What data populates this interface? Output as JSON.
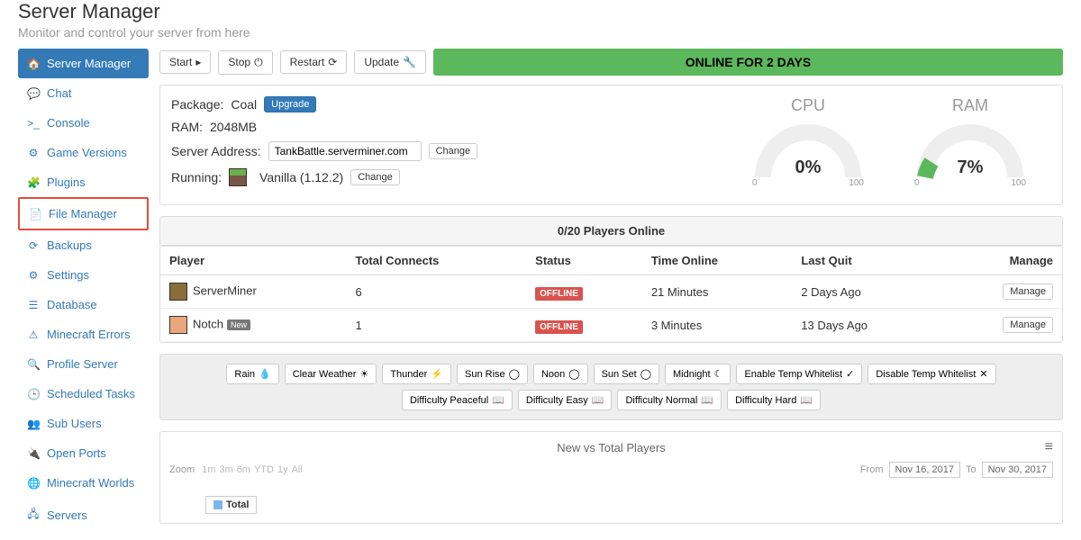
{
  "header": {
    "title": "Server Manager",
    "subtitle": "Monitor and control your server from here"
  },
  "sidebar": {
    "items": [
      {
        "icon": "🏠",
        "label": "Server Manager",
        "name": "server-manager"
      },
      {
        "icon": "💬",
        "label": "Chat",
        "name": "chat"
      },
      {
        "icon": ">_",
        "label": "Console",
        "name": "console"
      },
      {
        "icon": "⚙",
        "label": "Game Versions",
        "name": "game-versions"
      },
      {
        "icon": "🧩",
        "label": "Plugins",
        "name": "plugins"
      },
      {
        "icon": "📄",
        "label": "File Manager",
        "name": "file-manager"
      },
      {
        "icon": "⟳",
        "label": "Backups",
        "name": "backups"
      },
      {
        "icon": "⚙",
        "label": "Settings",
        "name": "settings"
      },
      {
        "icon": "☰",
        "label": "Database",
        "name": "database"
      },
      {
        "icon": "⚠",
        "label": "Minecraft Errors",
        "name": "minecraft-errors"
      },
      {
        "icon": "🔍",
        "label": "Profile Server",
        "name": "profile-server"
      },
      {
        "icon": "🕒",
        "label": "Scheduled Tasks",
        "name": "scheduled-tasks"
      },
      {
        "icon": "👥",
        "label": "Sub Users",
        "name": "sub-users"
      },
      {
        "icon": "🔌",
        "label": "Open Ports",
        "name": "open-ports"
      },
      {
        "icon": "🌐",
        "label": "Minecraft Worlds",
        "name": "minecraft-worlds"
      },
      {
        "icon": "🖧",
        "label": "Servers",
        "name": "servers"
      }
    ]
  },
  "toolbar": {
    "start": "Start",
    "stop": "Stop",
    "restart": "Restart",
    "update": "Update",
    "status": "ONLINE FOR 2 DAYS"
  },
  "info": {
    "package_label": "Package:",
    "package_value": "Coal",
    "upgrade": "Upgrade",
    "ram_label": "RAM:",
    "ram_value": "2048MB",
    "address_label": "Server Address:",
    "address_value": "TankBattle.serverminer.com",
    "change": "Change",
    "running_label": "Running:",
    "running_value": "Vanilla (1.12.2)"
  },
  "gauges": {
    "cpu": {
      "title": "CPU",
      "value": "0%",
      "min": "0",
      "max": "100",
      "pct": 0
    },
    "ram": {
      "title": "RAM",
      "value": "7%",
      "min": "0",
      "max": "100",
      "pct": 7
    }
  },
  "players": {
    "header": "0/20 Players Online",
    "columns": [
      "Player",
      "Total Connects",
      "Status",
      "Time Online",
      "Last Quit",
      "Manage"
    ],
    "rows": [
      {
        "name": "ServerMiner",
        "new": false,
        "connects": "6",
        "status": "OFFLINE",
        "time": "21 Minutes",
        "quit": "2 Days Ago",
        "manage": "Manage"
      },
      {
        "name": "Notch",
        "new": true,
        "connects": "1",
        "status": "OFFLINE",
        "time": "3 Minutes",
        "quit": "13 Days Ago",
        "manage": "Manage"
      }
    ],
    "new_badge": "New"
  },
  "actions": [
    {
      "label": "Rain",
      "icon": "💧"
    },
    {
      "label": "Clear Weather",
      "icon": "☀"
    },
    {
      "label": "Thunder",
      "icon": "⚡"
    },
    {
      "label": "Sun Rise",
      "icon": "◯"
    },
    {
      "label": "Noon",
      "icon": "◯"
    },
    {
      "label": "Sun Set",
      "icon": "◯"
    },
    {
      "label": "Midnight",
      "icon": "☾"
    },
    {
      "label": "Enable Temp Whitelist",
      "icon": "✓"
    },
    {
      "label": "Disable Temp Whitelist",
      "icon": "✕"
    },
    {
      "label": "Difficulty Peaceful",
      "icon": "📖"
    },
    {
      "label": "Difficulty Easy",
      "icon": "📖"
    },
    {
      "label": "Difficulty Normal",
      "icon": "📖"
    },
    {
      "label": "Difficulty Hard",
      "icon": "📖"
    }
  ],
  "chart": {
    "title": "New vs Total Players",
    "zoom_label": "Zoom",
    "zoom_options": [
      "1m",
      "3m",
      "6m",
      "YTD",
      "1y",
      "All"
    ],
    "from_label": "From",
    "from_value": "Nov 16, 2017",
    "to_label": "To",
    "to_value": "Nov 30, 2017",
    "legend": "Total"
  },
  "chart_data": {
    "type": "line",
    "title": "New vs Total Players",
    "x_range": [
      "2017-11-16",
      "2017-11-30"
    ],
    "series": [
      {
        "name": "Total",
        "color": "#7cb5ec",
        "values": []
      }
    ]
  }
}
